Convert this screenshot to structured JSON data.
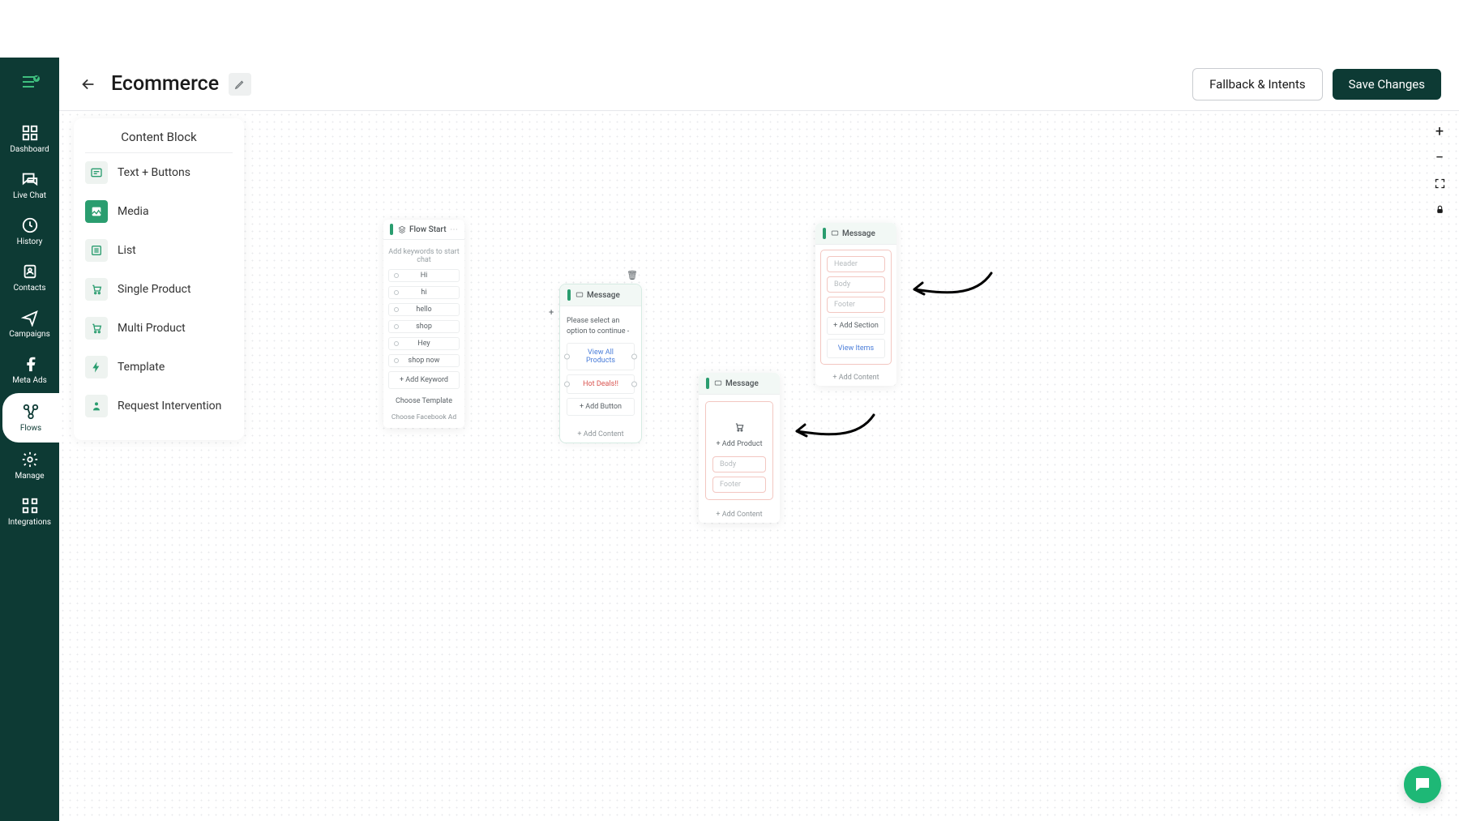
{
  "topbar": {
    "title": "Ecommerce",
    "fallback_btn": "Fallback & Intents",
    "save_btn": "Save Changes"
  },
  "sidebar": {
    "items": [
      {
        "label": "Dashboard"
      },
      {
        "label": "Live Chat"
      },
      {
        "label": "History"
      },
      {
        "label": "Contacts"
      },
      {
        "label": "Campaigns"
      },
      {
        "label": "Meta Ads"
      },
      {
        "label": "Flows"
      },
      {
        "label": "Manage"
      },
      {
        "label": "Integrations"
      }
    ]
  },
  "panel": {
    "title": "Content Block",
    "blocks": [
      {
        "label": "Text + Buttons"
      },
      {
        "label": "Media"
      },
      {
        "label": "List"
      },
      {
        "label": "Single Product"
      },
      {
        "label": "Multi Product"
      },
      {
        "label": "Template"
      },
      {
        "label": "Request Intervention"
      }
    ]
  },
  "nodes": {
    "flow_start": {
      "title": "Flow Start",
      "hint": "Add keywords to start chat",
      "keywords": [
        "Hi",
        "hi",
        "hello",
        "shop",
        "Hey",
        "shop now"
      ],
      "add_keyword": "+ Add Keyword",
      "choose_template": "Choose Template",
      "choose_ad": "Choose Facebook Ad"
    },
    "msg1": {
      "title": "Message",
      "text": "Please select an option to continue -",
      "btn1": "View All Products",
      "btn2": "Hot Deals!!",
      "add_button": "+ Add Button",
      "add_content": "+ Add Content"
    },
    "msg2": {
      "title": "Message",
      "header": "Header",
      "body": "Body",
      "footer": "Footer",
      "add_section": "+ Add Section",
      "view_items": "View Items",
      "add_content": "+ Add Content"
    },
    "msg3": {
      "title": "Message",
      "add_product": "+ Add Product",
      "body": "Body",
      "footer": "Footer",
      "add_content": "+ Add Content"
    }
  }
}
